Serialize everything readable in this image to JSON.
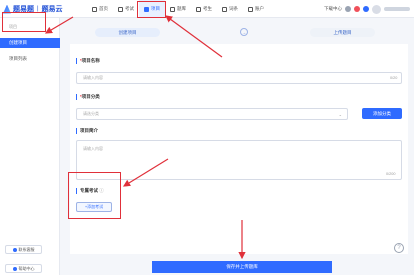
{
  "app": {
    "brand_primary": "题易题",
    "brand_secondary": "题易云"
  },
  "nav": {
    "items": [
      {
        "label": "首页",
        "icon": "home-icon"
      },
      {
        "label": "考试",
        "icon": "exam-icon"
      },
      {
        "label": "项目",
        "icon": "project-icon",
        "active": true
      },
      {
        "label": "题库",
        "icon": "question-bank-icon"
      },
      {
        "label": "考生",
        "icon": "candidate-icon"
      },
      {
        "label": "词条",
        "icon": "entry-icon"
      },
      {
        "label": "账户",
        "icon": "account-icon"
      }
    ]
  },
  "header_right": {
    "download_center": "下载中心"
  },
  "sidebar": {
    "section_label": "项目",
    "active_item": "创建项目",
    "items": [
      "项目列表"
    ],
    "buttons": [
      "联系客服",
      "帮助中心"
    ]
  },
  "steps": {
    "step1": "创建项目",
    "step2": "上传题目",
    "arrow": "→"
  },
  "form": {
    "name_label": "项目名称",
    "name_placeholder": "请输入内容",
    "name_counter": "0/20",
    "category_label": "项目分类",
    "category_placeholder": "请选分类",
    "add_category_btn": "添加分类",
    "intro_label": "项目简介",
    "intro_placeholder": "请输入内容",
    "intro_counter": "0/200",
    "spec_label": "专属考试",
    "spec_button": "+添加考试"
  },
  "help": "?",
  "submit_label": "保存并上传题库",
  "colors": {
    "accent": "#2f6bff",
    "annotation": "#e0303a"
  }
}
